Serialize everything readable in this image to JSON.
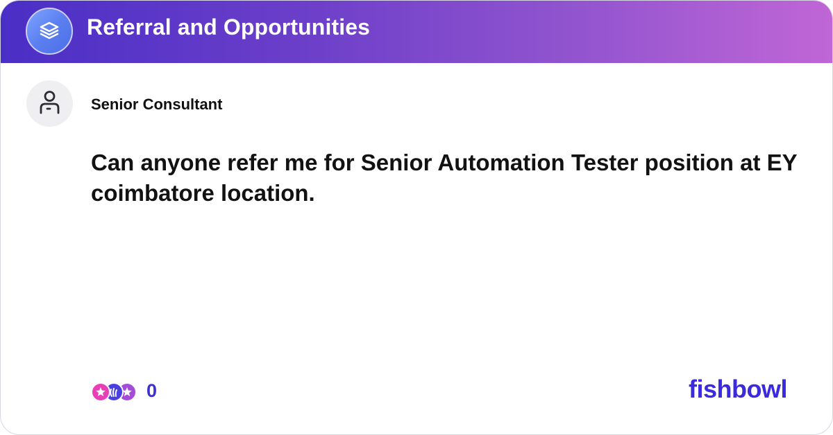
{
  "header": {
    "title": "Referral and Opportunities",
    "logo_icon": "layers-icon",
    "gradient_start": "#4a2fc6",
    "gradient_end": "#c066d6"
  },
  "post": {
    "author_title": "Senior Consultant",
    "avatar_icon": "person-icon",
    "body": "Can anyone refer me for Senior Automation Tester position at EY coimbatore location."
  },
  "footer": {
    "reaction_icons": [
      "star-reaction-icon",
      "clap-reaction-icon",
      "star-reaction-icon"
    ],
    "reaction_count": "0",
    "brand": "fishbowl",
    "brand_color": "#3b2ae0"
  }
}
